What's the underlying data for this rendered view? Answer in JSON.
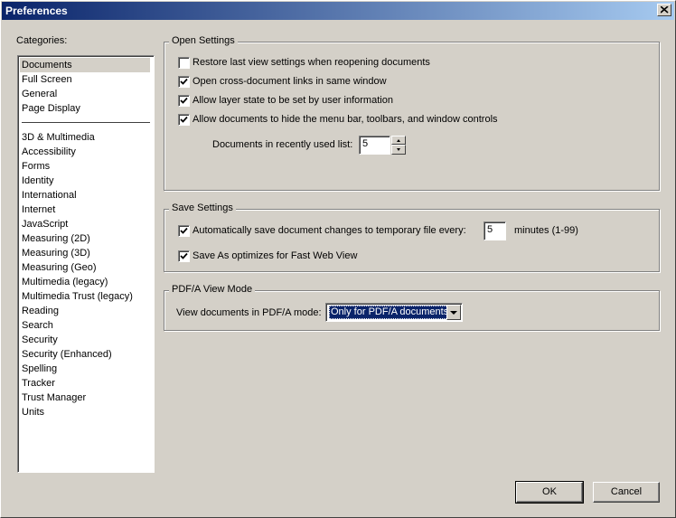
{
  "window": {
    "title": "Preferences"
  },
  "categories": {
    "label": "Categories:",
    "items": [
      {
        "label": "Documents",
        "selected": true
      },
      {
        "label": "Full Screen"
      },
      {
        "label": "General"
      },
      {
        "label": "Page Display"
      },
      {
        "label": "3D & Multimedia"
      },
      {
        "label": "Accessibility"
      },
      {
        "label": "Forms"
      },
      {
        "label": "Identity"
      },
      {
        "label": "International"
      },
      {
        "label": "Internet"
      },
      {
        "label": "JavaScript"
      },
      {
        "label": "Measuring (2D)"
      },
      {
        "label": "Measuring (3D)"
      },
      {
        "label": "Measuring (Geo)"
      },
      {
        "label": "Multimedia (legacy)"
      },
      {
        "label": "Multimedia Trust (legacy)"
      },
      {
        "label": "Reading"
      },
      {
        "label": "Search"
      },
      {
        "label": "Security"
      },
      {
        "label": "Security (Enhanced)"
      },
      {
        "label": "Spelling"
      },
      {
        "label": "Tracker"
      },
      {
        "label": "Trust Manager"
      },
      {
        "label": "Units"
      }
    ]
  },
  "open_settings": {
    "title": "Open Settings",
    "restore_last_view": {
      "label": "Restore last view settings when reopening documents",
      "checked": false
    },
    "cross_document_links": {
      "label": "Open cross-document links in same window",
      "checked": true
    },
    "layer_state": {
      "label": "Allow layer state to be set by user information",
      "checked": true
    },
    "hide_menu_bar": {
      "label": "Allow documents to hide the menu bar, toolbars, and window controls",
      "checked": true
    },
    "recent_list": {
      "label": "Documents in recently used list:",
      "value": "5"
    }
  },
  "save_settings": {
    "title": "Save Settings",
    "auto_save": {
      "label": "Automatically save document changes to temporary file every:",
      "checked": true,
      "value": "5",
      "suffix": "minutes (1-99)"
    },
    "fast_web_view": {
      "label": "Save As optimizes for Fast Web View",
      "checked": true
    }
  },
  "pdfa": {
    "title": "PDF/A View Mode",
    "label": "View documents in PDF/A mode:",
    "selected": "Only for PDF/A documents"
  },
  "buttons": {
    "ok": "OK",
    "cancel": "Cancel"
  }
}
